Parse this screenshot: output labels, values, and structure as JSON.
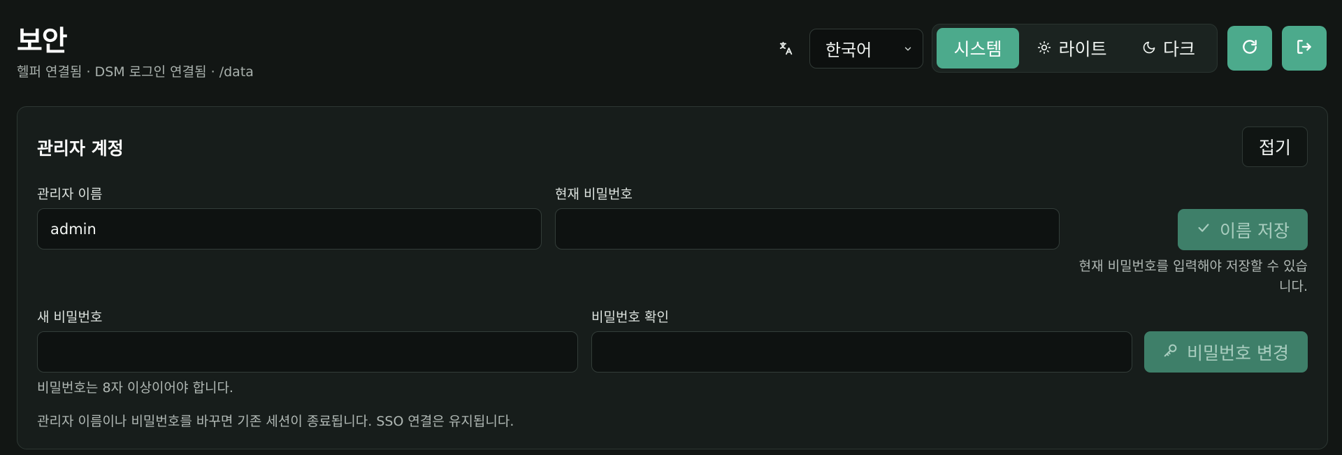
{
  "header": {
    "title": "보안",
    "subtitle": "헬퍼 연결됨 · DSM 로그인 연결됨 · /data",
    "language": {
      "icon": "translate-icon",
      "selected": "한국어"
    },
    "theme": {
      "system_label": "시스템",
      "light_label": "라이트",
      "dark_label": "다크",
      "active": "system"
    },
    "refresh_icon": "refresh-icon",
    "logout_icon": "logout-icon"
  },
  "admin_account": {
    "title": "관리자 계정",
    "collapse_label": "접기",
    "username": {
      "label": "관리자 이름",
      "value": "admin"
    },
    "current_password": {
      "label": "현재 비밀번호",
      "value": ""
    },
    "save_name_label": "이름 저장",
    "save_name_hint_line1": "현재 비밀번호를 입력해야 저장할 수 있습",
    "save_name_hint_line2": "니다.",
    "new_password": {
      "label": "새 비밀번호",
      "value": ""
    },
    "confirm_password": {
      "label": "비밀번호 확인",
      "value": ""
    },
    "change_password_label": "비밀번호 변경",
    "password_rule": "비밀번호는 8자 이상이어야 합니다.",
    "session_note": "관리자 이름이나 비밀번호를 바꾸면 기존 세션이 종료됩니다. SSO 연결은 유지됩니다."
  },
  "colors": {
    "background": "#121614",
    "accent": "#4caa8c",
    "accent_disabled": "#3e7f69"
  }
}
